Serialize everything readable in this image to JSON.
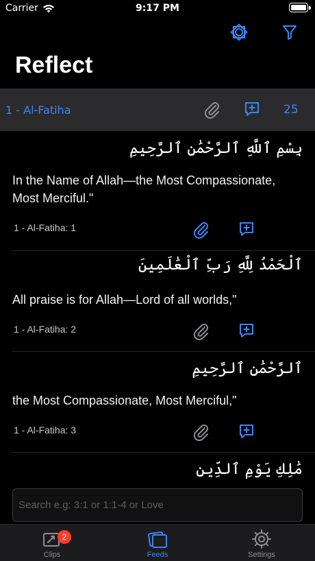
{
  "status_bar": {
    "carrier": "Carrier",
    "time": "9:17 PM"
  },
  "toolbar": {
    "icons": [
      "quran-emblem-icon",
      "filter-icon"
    ]
  },
  "page": {
    "title": "Reflect"
  },
  "surah": {
    "name": "1 - Al-Fatiha",
    "count": "25"
  },
  "verses": [
    {
      "arabic": "بِسْمِ ٱللَّهِ ٱلرَّحْمَٰنِ ٱلرَّحِيمِ",
      "translation": "In the Name of Allah—the Most Compassionate, Most Merciful.\"",
      "ref": "1 - Al-Fatiha: 1"
    },
    {
      "arabic": "ٱلْحَمْدُ لِلَّهِ رَبِّ ٱلْعَٰلَمِينَ",
      "translation": "All praise is for Allah—Lord of all worlds,\"",
      "ref": "1 - Al-Fatiha: 2"
    },
    {
      "arabic": "ٱلرَّحْمَٰنِ ٱلرَّحِيمِ",
      "translation": "the Most Compassionate, Most Merciful,\"",
      "ref": "1 - Al-Fatiha: 3"
    },
    {
      "arabic": "مَٰلِكِ يَوْمِ ٱلدِّينِ"
    }
  ],
  "search": {
    "placeholder": "Search e.g: 3:1 or 1:1-4 or Love",
    "value": ""
  },
  "tabs": [
    {
      "label": "Clips",
      "badge": "2"
    },
    {
      "label": "Feeds"
    },
    {
      "label": "Settings"
    }
  ],
  "colors": {
    "accent": "#3a86f5",
    "surah_row_bg": "#2b2b2e",
    "badge": "#ff3b30"
  }
}
